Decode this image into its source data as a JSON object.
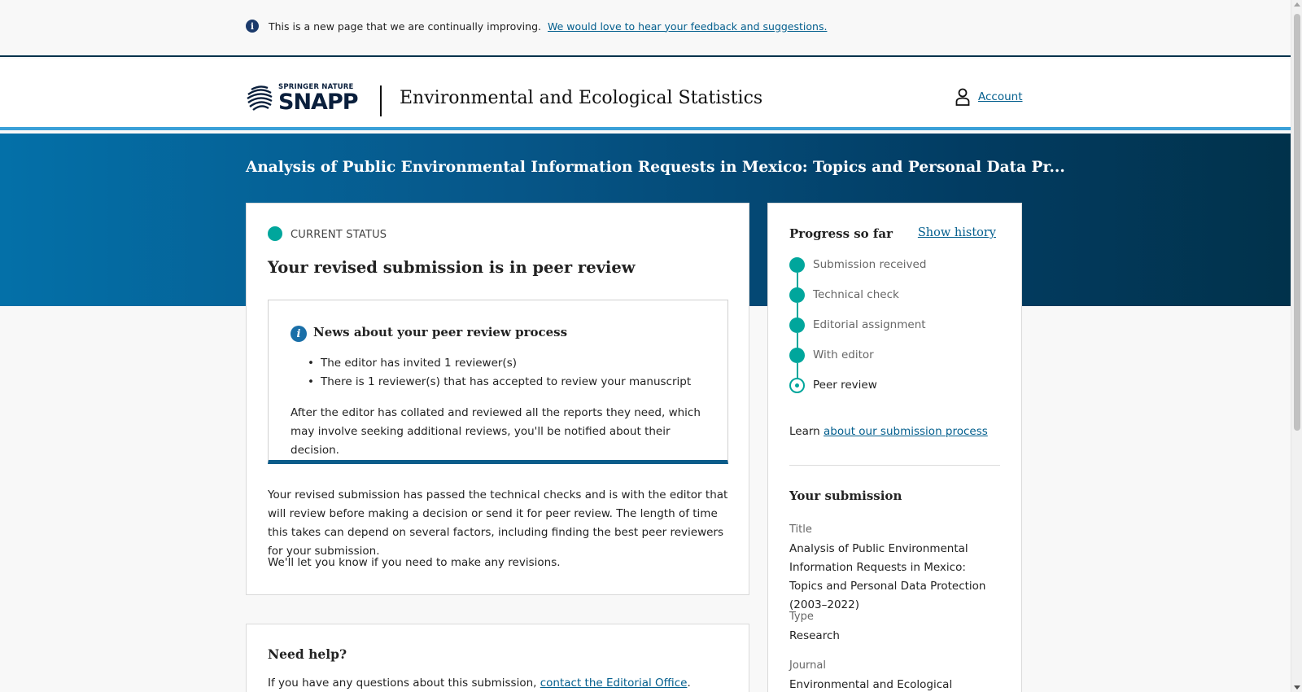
{
  "feedback_bar": {
    "icon": "info-icon",
    "message": "This is a new page that we are continually improving.",
    "link_text": "We would love to hear your feedback and suggestions."
  },
  "header": {
    "logo_top": "SPRINGER NATURE",
    "logo_main": "SNAPP",
    "journal_title": "Environmental and Ecological Statistics",
    "account_icon": "user-icon",
    "account_label": "Account"
  },
  "hero": {
    "title": "Analysis of Public Environmental Information Requests in Mexico: Topics and Personal Data Pr..."
  },
  "status": {
    "label": "CURRENT STATUS",
    "heading": "Your revised submission is in peer review",
    "news": {
      "icon": "info-icon",
      "title": "News about your peer review process",
      "items": [
        "The editor has invited 1 reviewer(s)",
        "There is 1 reviewer(s) that has accepted to review your manuscript"
      ],
      "paragraph": "After the editor has collated and reviewed all the reports they need, which may involve seeking additional reviews, you'll be notified about their decision."
    },
    "paragraph1": "Your revised submission has passed the technical checks and is with the editor that will review before making a decision or send it for peer review. The length of time this takes can depend on several factors, including finding the best peer reviewers for your submission.",
    "paragraph2": "We'll let you know if you need to make any revisions."
  },
  "help": {
    "title": "Need help?",
    "text_before": "If you have any questions about this submission, ",
    "link_text": "contact the Editorial Office",
    "text_after": "."
  },
  "progress": {
    "title": "Progress so far",
    "show_history": "Show history",
    "steps": [
      {
        "label": "Submission received",
        "state": "complete"
      },
      {
        "label": "Technical check",
        "state": "complete"
      },
      {
        "label": "Editorial assignment",
        "state": "complete"
      },
      {
        "label": "With editor",
        "state": "complete"
      },
      {
        "label": "Peer review",
        "state": "current"
      }
    ],
    "learn_prefix": "Learn ",
    "learn_link": "about our submission process"
  },
  "submission": {
    "heading": "Your submission",
    "title_label": "Title",
    "title_value": "Analysis of Public Environmental Information Requests in Mexico: Topics and Personal Data Protection (2003–2022)",
    "type_label": "Type",
    "type_value": "Research",
    "journal_label": "Journal",
    "journal_value": "Environmental and Ecological Statistics"
  },
  "colors": {
    "accent_teal": "#00a69c",
    "link_blue": "#025e8d",
    "hero_dark": "#01324b"
  }
}
